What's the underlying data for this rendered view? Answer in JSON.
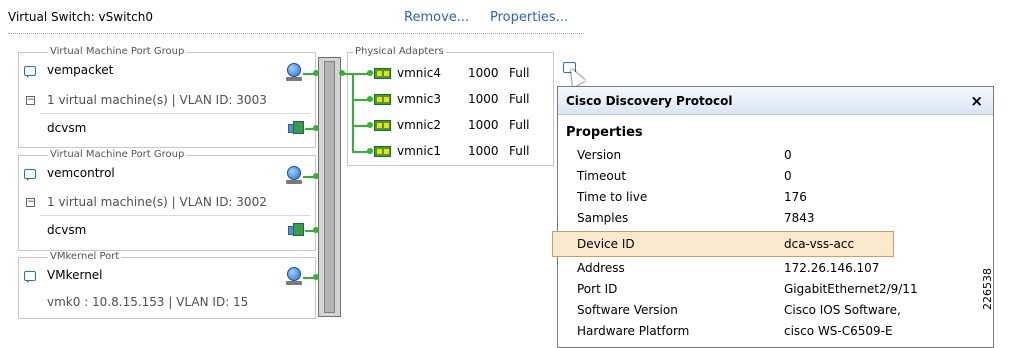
{
  "header": {
    "title": "Virtual Switch: vSwitch0",
    "remove_link": "Remove...",
    "properties_link": "Properties..."
  },
  "port_groups": [
    {
      "group_label": "Virtual Machine Port Group",
      "name": "vempacket",
      "info": "1 virtual machine(s) | VLAN ID: 3003",
      "vm": "dcvsm",
      "icon": "globe-icon"
    },
    {
      "group_label": "Virtual Machine Port Group",
      "name": "vemcontrol",
      "info": "1 virtual machine(s) | VLAN ID: 3002",
      "vm": "dcvsm",
      "icon": "globe-icon"
    },
    {
      "group_label": "VMkernel Port",
      "name": "VMkernel",
      "info": "vmk0 : 10.8.15.153 | VLAN ID: 15",
      "icon": "globe-icon"
    }
  ],
  "physical_adapters": {
    "label": "Physical Adapters",
    "items": [
      {
        "name": "vmnic4",
        "speed": "1000",
        "duplex": "Full"
      },
      {
        "name": "vmnic3",
        "speed": "1000",
        "duplex": "Full"
      },
      {
        "name": "vmnic2",
        "speed": "1000",
        "duplex": "Full"
      },
      {
        "name": "vmnic1",
        "speed": "1000",
        "duplex": "Full"
      }
    ]
  },
  "cdp_popup": {
    "title": "Cisco Discovery Protocol",
    "close_glyph": "×",
    "section": "Properties",
    "highlighted_row": "Device ID",
    "rows": [
      {
        "key": "Version",
        "value": "0"
      },
      {
        "key": "Timeout",
        "value": "0"
      },
      {
        "key": "Time to live",
        "value": "176"
      },
      {
        "key": "Samples",
        "value": "7843"
      },
      {
        "key": "Device ID",
        "value": "dca-vss-acc"
      },
      {
        "key": "Address",
        "value": "172.26.146.107"
      },
      {
        "key": "Port ID",
        "value": "GigabitEthernet2/9/11"
      },
      {
        "key": "Software Version",
        "value": "Cisco IOS Software,"
      },
      {
        "key": "Hardware Platform",
        "value": "cisco WS-C6509-E"
      }
    ]
  },
  "figure_id": "226538",
  "colors": {
    "link": "#2e63c9",
    "wire": "#2fb52f",
    "highlight_fill": "#fbe9cb",
    "highlight_border": "#c9a067"
  }
}
